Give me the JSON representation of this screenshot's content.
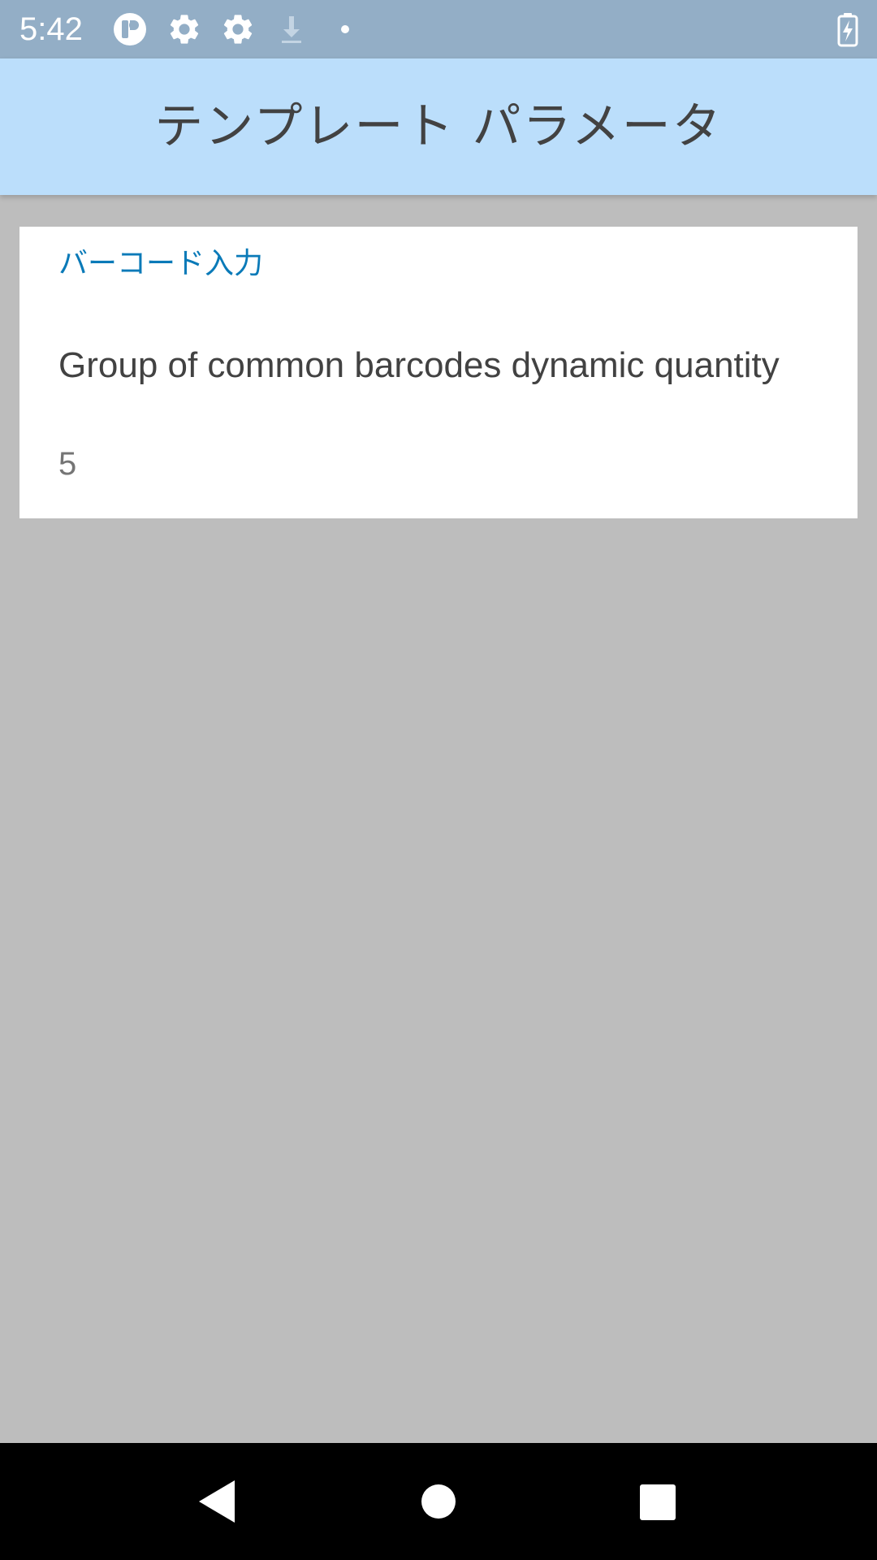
{
  "status_bar": {
    "time": "5:42",
    "icons": [
      "app-notification-icon",
      "settings-icon",
      "settings-icon",
      "download-icon",
      "dot-icon",
      "battery-charging-icon"
    ]
  },
  "app_bar": {
    "title": "テンプレート パラメータ"
  },
  "preferences": {
    "category": "バーコード入力",
    "item": {
      "title": "Group of common barcodes dynamic quantity",
      "summary": "5"
    }
  },
  "nav_bar": {
    "buttons": [
      "back-icon",
      "home-icon",
      "recents-icon"
    ]
  },
  "colors": {
    "status_bar": "#93aec6",
    "app_bar": "#bbdefb",
    "background": "#bdbdbd",
    "accent": "#0a7ab8"
  }
}
